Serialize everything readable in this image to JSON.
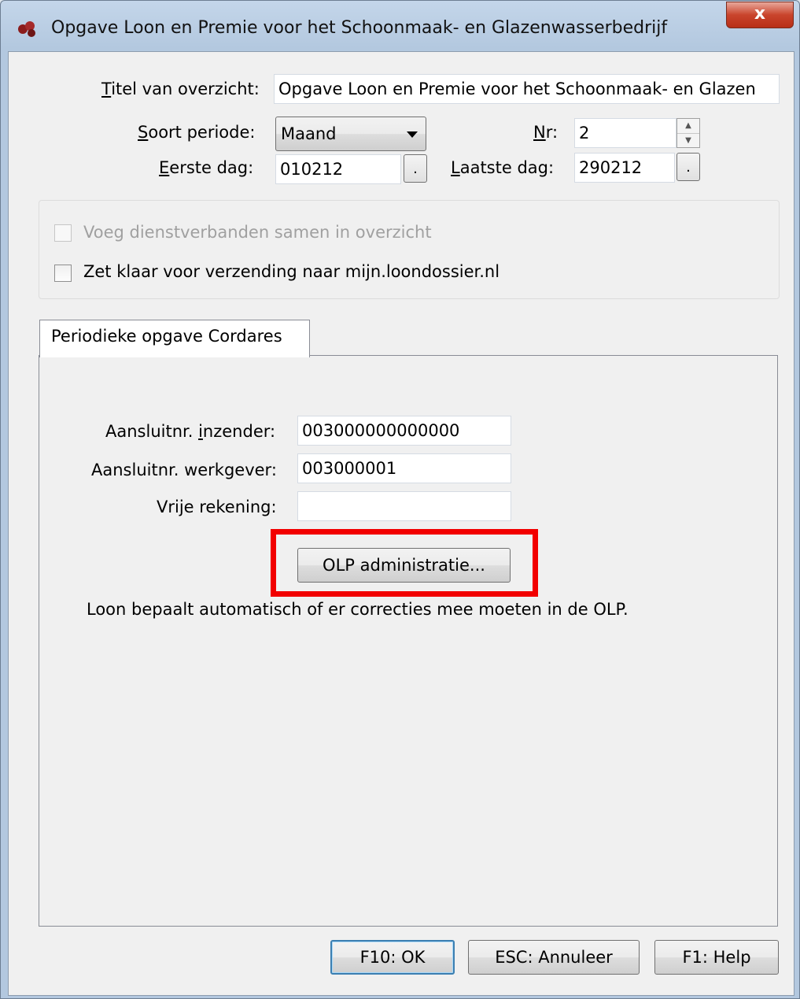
{
  "window": {
    "title": "Opgave Loon en Premie voor het Schoonmaak- en Glazenwasserbedrijf",
    "close_label": "x"
  },
  "form": {
    "titel_label_accel": "T",
    "titel_label_rest": "itel van overzicht:",
    "titel_value": "Opgave Loon en Premie voor het Schoonmaak- en Glazen",
    "soort_label_accel": "S",
    "soort_label_rest": "oort periode:",
    "soort_value": "Maand",
    "nr_label_accel": "N",
    "nr_label_rest": "r:",
    "nr_value": "2",
    "eerste_label_accel": "E",
    "eerste_label_rest": "erste dag:",
    "eerste_value": "010212",
    "laatste_label_accel": "L",
    "laatste_label_rest": "aatste dag:",
    "laatste_value": "290212",
    "picker_label": "."
  },
  "options": {
    "voeg_label": "Voeg dienstverbanden samen in overzicht",
    "zet_label": "Zet klaar voor verzending naar mijn.loondossier.nl"
  },
  "tab": {
    "label": "Periodieke opgave Cordares",
    "inzender_label_pre": "Aansluitnr. ",
    "inzender_label_accel": "i",
    "inzender_label_rest": "nzender:",
    "inzender_value": "003000000000000",
    "werkgever_label": "Aansluitnr. werkgever:",
    "werkgever_value": "003000001",
    "vrije_label": "Vrije rekening:",
    "vrije_value": "",
    "olp_button": "OLP administratie...",
    "info_text": "Loon bepaalt automatisch of er correcties mee moeten in de OLP."
  },
  "buttons": {
    "ok": "F10: OK",
    "cancel": "ESC: Annuleer",
    "help": "F1: Help"
  },
  "colors": {
    "highlight": "#f20000"
  }
}
